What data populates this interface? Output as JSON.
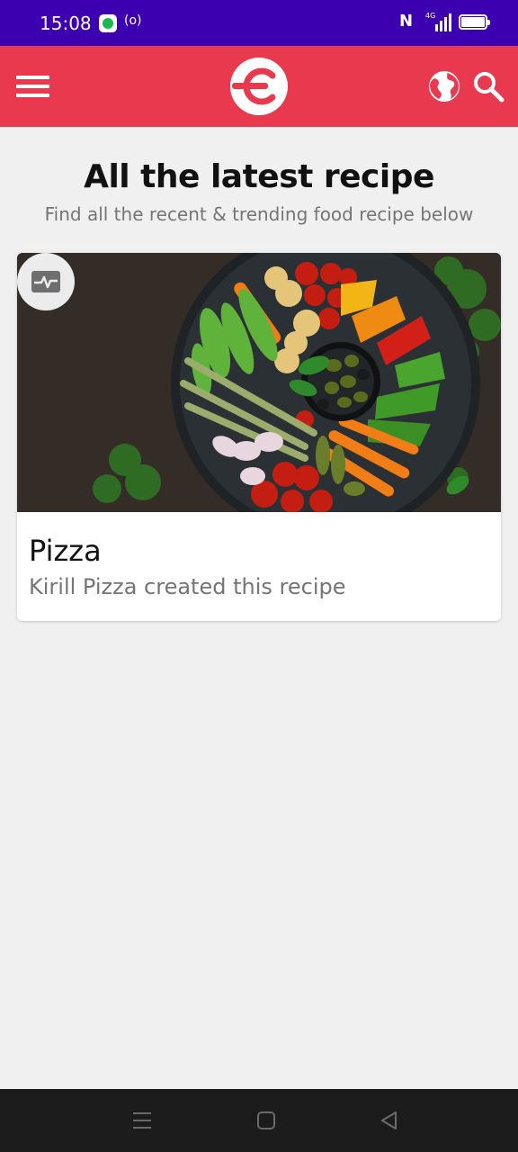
{
  "status_bar": {
    "time": "15:08",
    "radio_indicator": "(o)",
    "nfc": "N",
    "network_type": "4G",
    "icons": [
      "chat-icon",
      "radio-icon",
      "nfc-icon",
      "signal-icon",
      "battery-icon"
    ]
  },
  "app_bar": {
    "icons": [
      "menu-icon",
      "logo",
      "globe-icon",
      "search-icon"
    ],
    "color": "#e9394f"
  },
  "main": {
    "title": "All the latest recipe",
    "subtitle": "Find all the recent & trending food recipe below"
  },
  "recipes": [
    {
      "title": "Pizza",
      "subtitle": "Kirill Pizza created this recipe",
      "image_icon": "food-photo",
      "badge_icon": "activity-icon"
    }
  ],
  "nav_bar": {
    "icons": [
      "recents-icon",
      "home-icon",
      "back-icon"
    ]
  },
  "colors": {
    "status_bar": "#3d00b0",
    "accent": "#e9394f",
    "background": "#f0f0f0"
  }
}
